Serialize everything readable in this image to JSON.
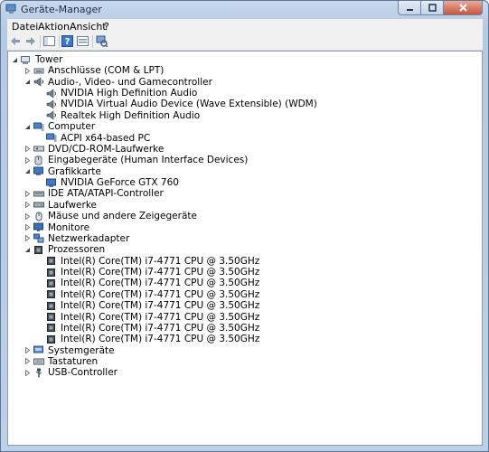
{
  "window": {
    "title": "Geräte-Manager"
  },
  "menu": {
    "items": [
      "Datei",
      "Aktion",
      "Ansicht",
      "?"
    ]
  },
  "tree": [
    {
      "level": 0,
      "state": "expanded",
      "icon": "computer-icon",
      "label": "Tower"
    },
    {
      "level": 1,
      "state": "collapsed",
      "icon": "port-icon",
      "label": "Anschlüsse (COM & LPT)"
    },
    {
      "level": 1,
      "state": "expanded",
      "icon": "speaker-icon",
      "label": "Audio-, Video- und Gamecontroller"
    },
    {
      "level": 2,
      "state": "leaf",
      "icon": "speaker-icon",
      "label": "NVIDIA High Definition Audio"
    },
    {
      "level": 2,
      "state": "leaf",
      "icon": "speaker-icon",
      "label": "NVIDIA Virtual Audio Device (Wave Extensible) (WDM)"
    },
    {
      "level": 2,
      "state": "leaf",
      "icon": "speaker-icon",
      "label": "Realtek High Definition Audio"
    },
    {
      "level": 1,
      "state": "expanded",
      "icon": "monitor-pc-icon",
      "label": "Computer"
    },
    {
      "level": 2,
      "state": "leaf",
      "icon": "monitor-pc-icon",
      "label": "ACPI x64-based PC"
    },
    {
      "level": 1,
      "state": "collapsed",
      "icon": "disc-drive-icon",
      "label": "DVD/CD-ROM-Laufwerke"
    },
    {
      "level": 1,
      "state": "collapsed",
      "icon": "hid-icon",
      "label": "Eingabegeräte (Human Interface Devices)"
    },
    {
      "level": 1,
      "state": "expanded",
      "icon": "display-adapter-icon",
      "label": "Grafikkarte"
    },
    {
      "level": 2,
      "state": "leaf",
      "icon": "display-adapter-icon",
      "label": "NVIDIA GeForce GTX 760"
    },
    {
      "level": 1,
      "state": "collapsed",
      "icon": "ide-controller-icon",
      "label": "IDE ATA/ATAPI-Controller"
    },
    {
      "level": 1,
      "state": "collapsed",
      "icon": "drive-icon",
      "label": "Laufwerke"
    },
    {
      "level": 1,
      "state": "collapsed",
      "icon": "mouse-icon",
      "label": "Mäuse und andere Zeigegeräte"
    },
    {
      "level": 1,
      "state": "collapsed",
      "icon": "monitor-icon",
      "label": "Monitore"
    },
    {
      "level": 1,
      "state": "collapsed",
      "icon": "network-icon",
      "label": "Netzwerkadapter"
    },
    {
      "level": 1,
      "state": "expanded",
      "icon": "processor-icon",
      "label": "Prozessoren"
    },
    {
      "level": 2,
      "state": "leaf",
      "icon": "processor-icon",
      "label": "Intel(R) Core(TM) i7-4771 CPU @ 3.50GHz"
    },
    {
      "level": 2,
      "state": "leaf",
      "icon": "processor-icon",
      "label": "Intel(R) Core(TM) i7-4771 CPU @ 3.50GHz"
    },
    {
      "level": 2,
      "state": "leaf",
      "icon": "processor-icon",
      "label": "Intel(R) Core(TM) i7-4771 CPU @ 3.50GHz"
    },
    {
      "level": 2,
      "state": "leaf",
      "icon": "processor-icon",
      "label": "Intel(R) Core(TM) i7-4771 CPU @ 3.50GHz"
    },
    {
      "level": 2,
      "state": "leaf",
      "icon": "processor-icon",
      "label": "Intel(R) Core(TM) i7-4771 CPU @ 3.50GHz"
    },
    {
      "level": 2,
      "state": "leaf",
      "icon": "processor-icon",
      "label": "Intel(R) Core(TM) i7-4771 CPU @ 3.50GHz"
    },
    {
      "level": 2,
      "state": "leaf",
      "icon": "processor-icon",
      "label": "Intel(R) Core(TM) i7-4771 CPU @ 3.50GHz"
    },
    {
      "level": 2,
      "state": "leaf",
      "icon": "processor-icon",
      "label": "Intel(R) Core(TM) i7-4771 CPU @ 3.50GHz"
    },
    {
      "level": 1,
      "state": "collapsed",
      "icon": "system-devices-icon",
      "label": "Systemgeräte"
    },
    {
      "level": 1,
      "state": "collapsed",
      "icon": "keyboard-icon",
      "label": "Tastaturen"
    },
    {
      "level": 1,
      "state": "collapsed",
      "icon": "usb-icon",
      "label": "USB-Controller"
    }
  ]
}
